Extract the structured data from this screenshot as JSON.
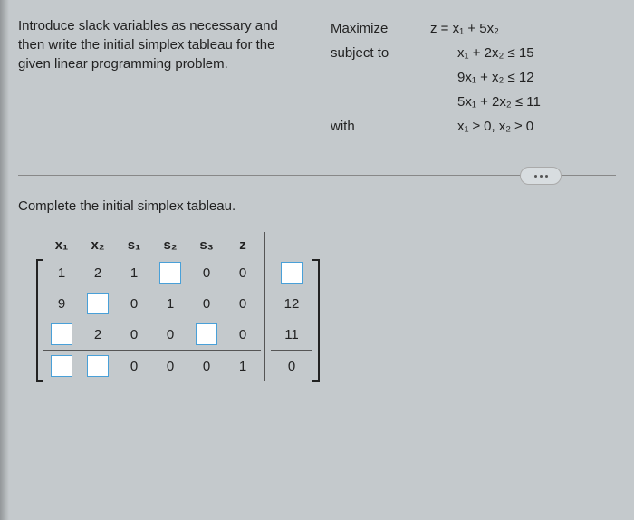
{
  "instructions": "Introduce slack variables as necessary and then write the initial simplex tableau for the given linear programming problem.",
  "problem": {
    "maximize_label": "Maximize",
    "objective": "z = x₁ + 5x₂",
    "subject_to_label": "subject to",
    "constraint1": "x₁ + 2x₂ ≤ 15",
    "constraint2": "9x₁ + x₂ ≤ 12",
    "constraint3": "5x₁ + 2x₂ ≤ 11",
    "with_label": "with",
    "nonneg": "x₁ ≥ 0, x₂ ≥ 0"
  },
  "tableau": {
    "title": "Complete the initial simplex tableau.",
    "headers": {
      "x1": "x₁",
      "x2": "x₂",
      "s1": "s₁",
      "s2": "s₂",
      "s3": "s₃",
      "z": "z"
    },
    "cells": {
      "r1c1": "1",
      "r1c2": "2",
      "r1c3": "1",
      "r1c5": "0",
      "r1c6": "0",
      "r2c1": "9",
      "r2c3": "0",
      "r2c4": "1",
      "r2c5": "0",
      "r2c6": "0",
      "r2rhs": "12",
      "r3c2": "2",
      "r3c3": "0",
      "r3c4": "0",
      "r3c6": "0",
      "r3rhs": "11",
      "r4c3": "0",
      "r4c4": "0",
      "r4c5": "0",
      "r4c6": "1",
      "r4rhs": "0"
    }
  }
}
